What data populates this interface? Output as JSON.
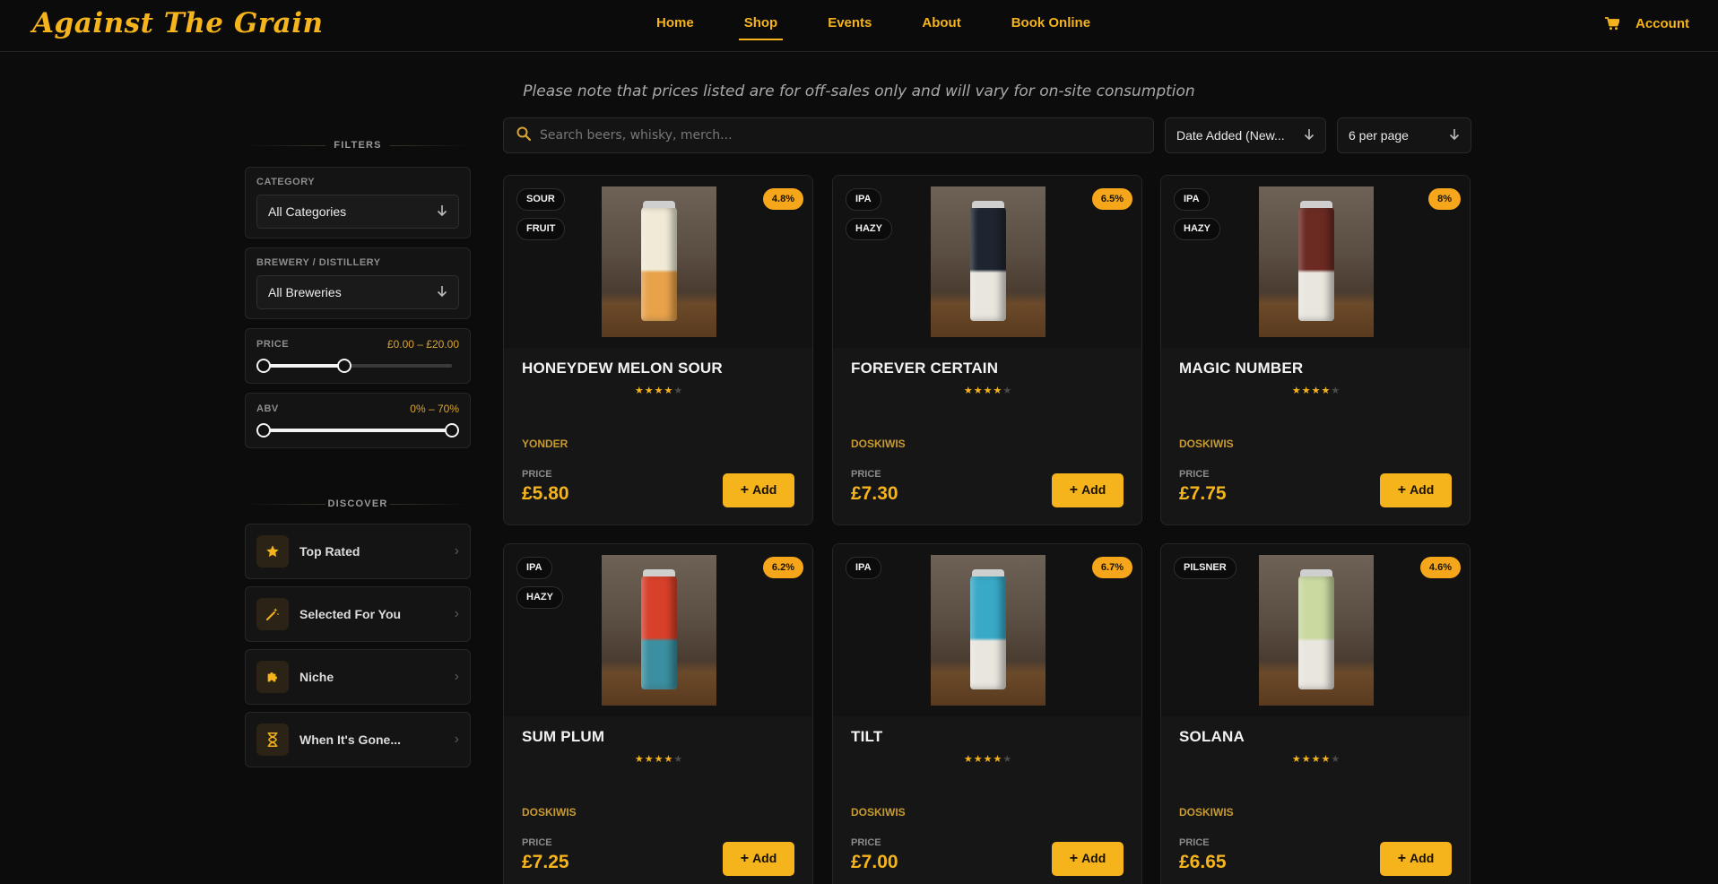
{
  "brand": {
    "logo": "Against The Grain"
  },
  "nav": {
    "links": [
      "Home",
      "Shop",
      "Events",
      "About",
      "Book Online"
    ],
    "active": "Shop",
    "account": "Account"
  },
  "notice": "Please note that prices listed are for off-sales only and will vary for on-site consumption",
  "search": {
    "placeholder": "Search beers, whisky, merch..."
  },
  "sort": {
    "value": "Date Added (New..."
  },
  "per_page": {
    "value": "6 per page"
  },
  "filters": {
    "heading": "FILTERS",
    "category": {
      "label": "CATEGORY",
      "value": "All Categories"
    },
    "brewery": {
      "label": "BREWERY / DISTILLERY",
      "value": "All Breweries"
    },
    "price": {
      "label": "PRICE",
      "range_text": "£0.00 – £20.00",
      "low_frac": 0.0,
      "high_frac": 0.43
    },
    "abv": {
      "label": "ABV",
      "range_text": "0% – 70%",
      "low_frac": 0.0,
      "high_frac": 1.0
    }
  },
  "discover": {
    "heading": "DISCOVER",
    "items": [
      {
        "label": "Top Rated",
        "icon": "star-icon"
      },
      {
        "label": "Selected For You",
        "icon": "magic-wand-icon"
      },
      {
        "label": "Niche",
        "icon": "puzzle-icon"
      },
      {
        "label": "When It's Gone...",
        "icon": "hourglass-icon"
      }
    ]
  },
  "colors": {
    "accent": "#f5b31c",
    "badge": "#f5a61b",
    "background": "#0c0c0c",
    "card": "#161616"
  },
  "products": [
    {
      "name": "HONEYDEW MELON SOUR",
      "tags": [
        "SOUR",
        "FRUIT"
      ],
      "abv": "4.8%",
      "rating": 4,
      "brewery": "YONDER",
      "price_label": "PRICE",
      "price": "£5.80",
      "add_label": "Add",
      "can_color": "#f0ead6",
      "can_accent": "#e8a24a"
    },
    {
      "name": "FOREVER CERTAIN",
      "tags": [
        "IPA",
        "HAZY"
      ],
      "abv": "6.5%",
      "rating": 4,
      "brewery": "DOSKIWIS",
      "price_label": "PRICE",
      "price": "£7.30",
      "add_label": "Add",
      "can_color": "#1e2530",
      "can_accent": "#e9e6de"
    },
    {
      "name": "MAGIC NUMBER",
      "tags": [
        "IPA",
        "HAZY"
      ],
      "abv": "8%",
      "rating": 4,
      "brewery": "DOSKIWIS",
      "price_label": "PRICE",
      "price": "£7.75",
      "add_label": "Add",
      "can_color": "#6b2a22",
      "can_accent": "#e9e6de"
    },
    {
      "name": "SUM PLUM",
      "tags": [
        "IPA",
        "HAZY"
      ],
      "abv": "6.2%",
      "rating": 4,
      "brewery": "DOSKIWIS",
      "price_label": "PRICE",
      "price": "£7.25",
      "add_label": "Add",
      "can_color": "#d8402a",
      "can_accent": "#3b8fa0"
    },
    {
      "name": "TILT",
      "tags": [
        "IPA"
      ],
      "abv": "6.7%",
      "rating": 4,
      "brewery": "DOSKIWIS",
      "price_label": "PRICE",
      "price": "£7.00",
      "add_label": "Add",
      "can_color": "#38a9c6",
      "can_accent": "#e9e6de"
    },
    {
      "name": "SOLANA",
      "tags": [
        "PILSNER"
      ],
      "abv": "4.6%",
      "rating": 4,
      "brewery": "DOSKIWIS",
      "price_label": "PRICE",
      "price": "£6.65",
      "add_label": "Add",
      "can_color": "#c9d9a0",
      "can_accent": "#e9e6de"
    }
  ]
}
